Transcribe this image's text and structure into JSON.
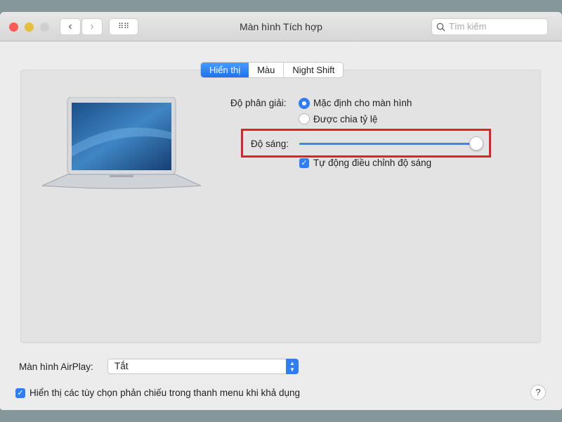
{
  "window": {
    "title": "Màn hình Tích hợp",
    "search_placeholder": "Tìm kiếm",
    "traffic_colors": {
      "close": "#fc5b57",
      "minimize": "#e5bf3c",
      "zoom": "#d0d0d0"
    }
  },
  "tabs": [
    {
      "label": "Hiển thị",
      "active": true
    },
    {
      "label": "Màu",
      "active": false
    },
    {
      "label": "Night Shift",
      "active": false
    }
  ],
  "display": {
    "resolution_label": "Độ phân giải:",
    "resolution_options": [
      {
        "label": "Mặc định cho màn hình",
        "selected": true
      },
      {
        "label": "Được chia tỷ lệ",
        "selected": false
      }
    ],
    "brightness_label": "Độ sáng:",
    "brightness_percent": 100,
    "auto_brightness_label": "Tự động điều chỉnh độ sáng",
    "auto_brightness_checked": true
  },
  "footer": {
    "airplay_label": "Màn hình AirPlay:",
    "airplay_value": "Tắt",
    "mirror_label": "Hiển thị các tùy chọn phản chiếu trong thanh menu khi khả dụng",
    "mirror_checked": true,
    "help": "?"
  },
  "colors": {
    "accent": "#2f7ef5",
    "highlight_box": "#e0202a"
  }
}
